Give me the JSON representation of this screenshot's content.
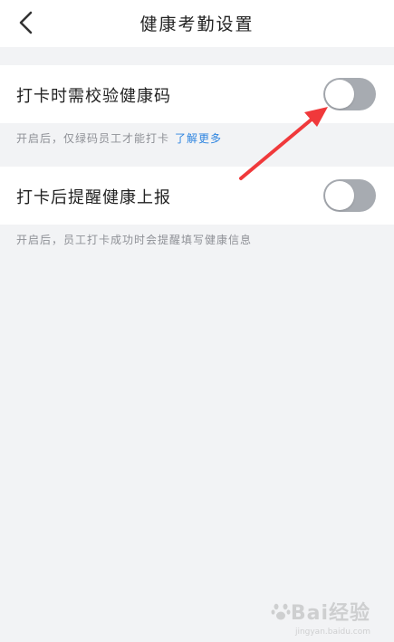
{
  "header": {
    "title": "健康考勤设置",
    "back_icon": "chevron-left-icon"
  },
  "settings": [
    {
      "label": "打卡时需校验健康码",
      "enabled": false,
      "hint": "开启后，仅绿码员工才能打卡",
      "hint_link": "了解更多"
    },
    {
      "label": "打卡后提醒健康上报",
      "enabled": false,
      "hint": "开启后，员工打卡成功时会提醒填写健康信息"
    }
  ],
  "watermark": {
    "text": "Bai经验",
    "sub": "jingyan.baidu.com"
  },
  "colors": {
    "background": "#f2f3f5",
    "toggle_off": "#a7abb1",
    "link": "#2f85e0",
    "arrow": "#f0393b"
  }
}
